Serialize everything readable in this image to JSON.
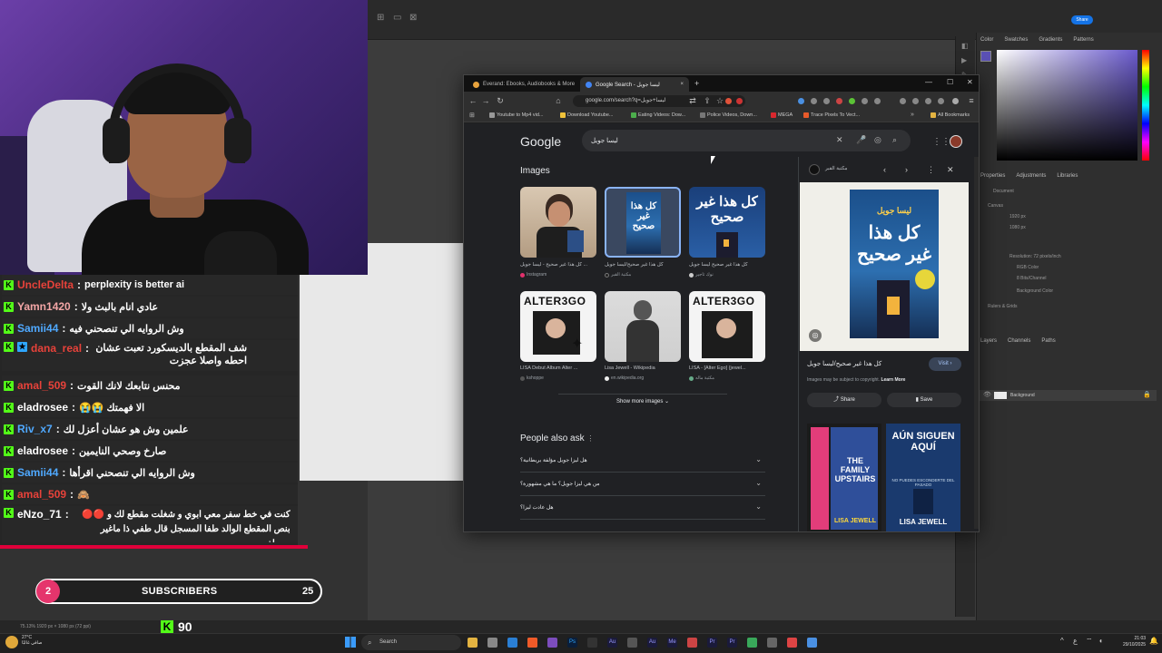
{
  "stream": {
    "chat": [
      {
        "user": "UncleDelta",
        "color": "#e8423a",
        "text": "perplexity is better ai",
        "rtl": false
      },
      {
        "user": "Yamn1420",
        "color": "#f3a6a6",
        "text": "عادي انام بالبث ولا",
        "rtl": true
      },
      {
        "user": "Samii44",
        "color": "#4fa9ff",
        "text": "وش الروايه الي تنصحني فيه",
        "rtl": true
      },
      {
        "user": "dana_real",
        "color": "#e8423a",
        "text": "شف المقطع بالديسكورد تعبت عشان احطه واصلا عجزت",
        "rtl": true
      },
      {
        "user": "amal_509",
        "color": "#e8423a",
        "text": "محنس نتابعك لانك القوت",
        "rtl": true
      },
      {
        "user": "eladrosee",
        "color": "#ffffff",
        "text": "الا فهمتك 😭😭",
        "rtl": true
      },
      {
        "user": "Riv_x7",
        "color": "#4fa9ff",
        "text": "علمين وش هو عشان أعزل لك",
        "rtl": true
      },
      {
        "user": "eladrosee",
        "color": "#ffffff",
        "text": "صارخ وصحي النايمين",
        "rtl": true
      },
      {
        "user": "Samii44",
        "color": "#4fa9ff",
        "text": "وش الروايه الي تنصحني اقرأها",
        "rtl": true
      },
      {
        "user": "amal_509",
        "color": "#e8423a",
        "text": "🙈",
        "rtl": true
      },
      {
        "user": "eNzo_71",
        "color": "#ffffff",
        "text": "كنت في خط سفر معي ابوي و شغلت مقطع لك و 🔴🔴 بنص المقطع الوالد طفا المسجل قال طفي ذا ماغير يسولف",
        "rtl": true
      }
    ],
    "subscribers": {
      "current": "2",
      "label": "SUBSCRIBERS",
      "goal": "25",
      "progress": 0.08
    },
    "kick_count": "90"
  },
  "photoshop": {
    "share_label": "Share",
    "panel_tabs_top": [
      "Color",
      "Swatches",
      "Gradients",
      "Patterns"
    ],
    "panel_tabs_mid": [
      "Properties",
      "Adjustments",
      "Libraries"
    ],
    "panel_tabs_bottom": [
      "Layers",
      "Channels",
      "Paths"
    ],
    "properties": {
      "document": "Document",
      "canvas": "Canvas",
      "width": "1920 px",
      "height": "1080 px",
      "resolution": "Resolution: 72 pixels/inch",
      "mode": "RGB Color",
      "depth": "8 Bits/Channel",
      "bg": "Background Color",
      "rulers": "Rulers & Grids"
    },
    "layer_name": "Background",
    "status": "75.13%     1920 px × 1080 px (72 ppi)"
  },
  "browser": {
    "tabs": [
      {
        "label": "Everand: Ebooks, Audiobooks & More",
        "active": false
      },
      {
        "label": "Google Search - ليسا جويل",
        "active": true
      }
    ],
    "url": "google.com/search?q=ليسا+جويل",
    "bookmarks": [
      "Youtube to Mp4 vid...",
      "Download Youtube...",
      "Eating Videos: Dow...",
      "Police Videos, Down...",
      "MEGA",
      "Trace Pixels To Vect..."
    ],
    "all_bookmarks": "All Bookmarks",
    "google": {
      "logo": "Google",
      "query": "ليسا جويل",
      "images_heading": "Images",
      "images": [
        {
          "caption": "كل هذا غير صحيح - ليسا جويل ...",
          "source": "Instagram"
        },
        {
          "caption": "كل هذا غير صحيح/ليسا جويل",
          "source": "مكتبة القبر"
        },
        {
          "caption": "كل هذا غير صحيح ليسا جويل",
          "source": "نوك تاجير"
        },
        {
          "caption": "LISA Debut Album Alter ...",
          "source": "kshoppe"
        },
        {
          "caption": "Lisa Jewell - Wikipedia",
          "source": "en.wikipedia.org"
        },
        {
          "caption": "LISA - [Alter Ego] {jewel...",
          "source": "مكتبة ماله"
        }
      ],
      "alterego_text": "ALTER3GO",
      "show_more": "Show more images",
      "paa_heading": "People also ask",
      "paa": [
        "هل ليزا جويل مؤلفة بريطانية؟",
        "من هي ليزا جويل؟ ما هي مشهورة؟",
        "هل عادت ليزا؟"
      ]
    },
    "side_panel": {
      "source": "مكتبة القبر",
      "title": "كل هذا غير صحيح/ليسا جويل",
      "visit": "Visit",
      "copyright": "Images may be subject to copyright.",
      "learn_more": "Learn More",
      "share": "Share",
      "save": "Save",
      "book_author": "ليسا جويل",
      "book_title_ar": "كل هذا غير صحيح",
      "related1_title": "THE FAMILY UPSTAIRS",
      "related1_author": "LISA JEWELL",
      "related2_title": "AÚN SIGUEN AQUÍ",
      "related2_sub": "NO PUEDES ESCONDERTE DEL PASADO",
      "related2_author": "LISA JEWELL"
    }
  },
  "taskbar": {
    "search": "Search",
    "weather_temp": "27°C",
    "weather_desc": "صافي غالبًا",
    "time": "21:03",
    "date": "29/10/2025"
  }
}
